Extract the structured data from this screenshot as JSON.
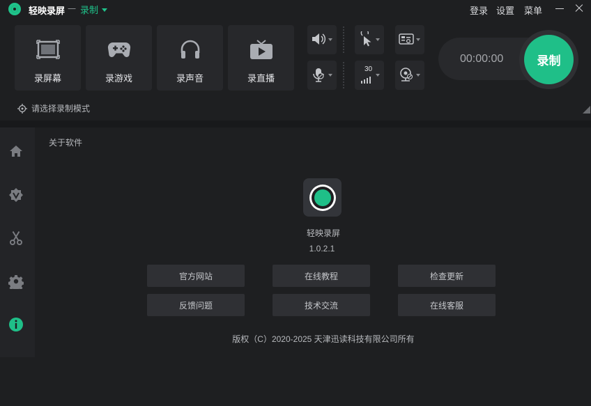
{
  "titlebar": {
    "app_name": "轻映录屏",
    "separator": "一",
    "mode": "录制",
    "login": "登录",
    "settings": "设置",
    "menu": "菜单"
  },
  "modes": [
    {
      "label": "录屏幕",
      "icon": "screen-icon"
    },
    {
      "label": "录游戏",
      "icon": "gamepad-icon"
    },
    {
      "label": "录声音",
      "icon": "headphones-icon"
    },
    {
      "label": "录直播",
      "icon": "tv-icon"
    }
  ],
  "tools": {
    "fps_value": "30"
  },
  "record": {
    "timer": "00:00:00",
    "button": "录制",
    "accent": "#1fbf88"
  },
  "hint": {
    "text": "请选择录制模式"
  },
  "about": {
    "title": "关于软件",
    "product_name": "轻映录屏",
    "version": "1.0.2.1",
    "links": [
      "官方网站",
      "在线教程",
      "检查更新",
      "反馈问题",
      "技术交流",
      "在线客服"
    ],
    "copyright": "版权（C）2020-2025 天津迅读科技有限公司所有"
  },
  "sidebar": {
    "items": [
      "home-icon",
      "vip-icon",
      "scissors-icon",
      "gear-icon",
      "info-icon"
    ],
    "active": "info-icon"
  }
}
